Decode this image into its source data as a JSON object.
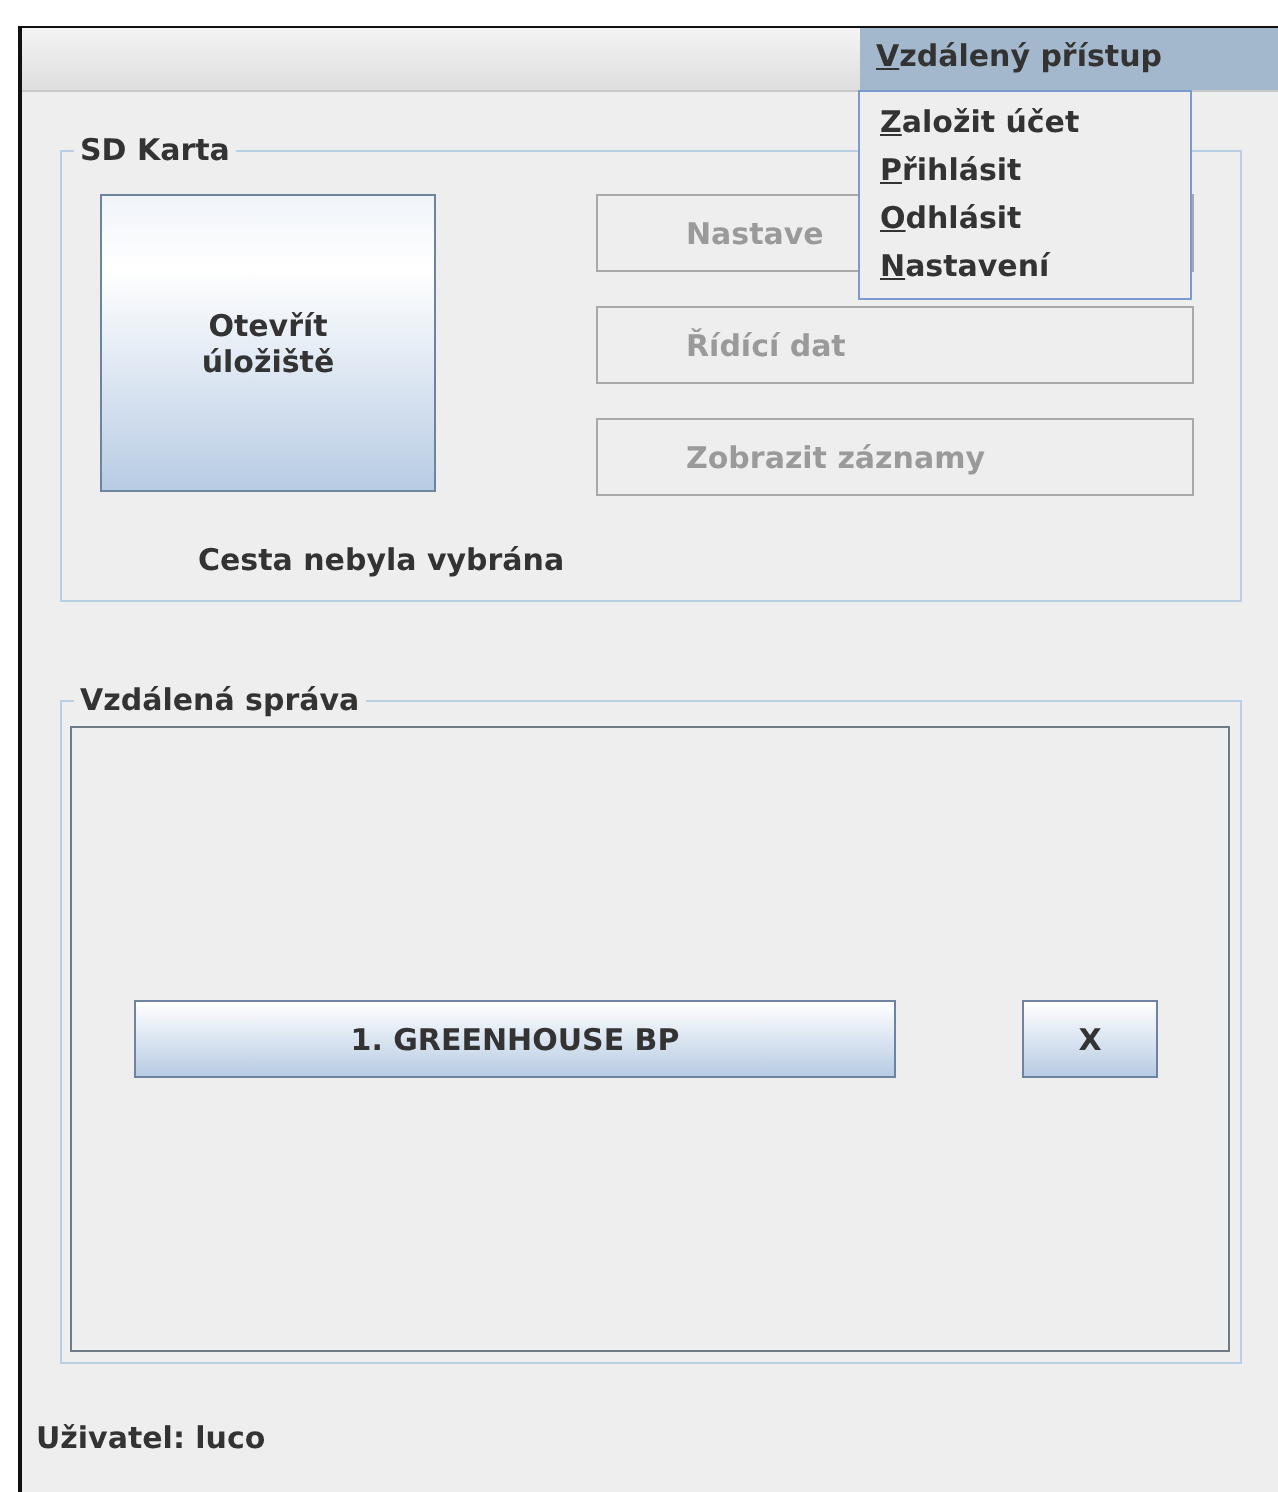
{
  "menu_bar": {
    "menus": [
      {
        "label": "Vzdálený přístup",
        "selected": true
      }
    ]
  },
  "open_menu": {
    "items": [
      {
        "label": "Založit účet"
      },
      {
        "label": "Přihlásit"
      },
      {
        "label": "Odhlásit"
      },
      {
        "label": "Nastavení"
      }
    ]
  },
  "sd_card": {
    "title": "SD Karta",
    "open_button": "Otevřít úložiště",
    "buttons": [
      {
        "label": "Nastave",
        "disabled": true
      },
      {
        "label": "Řídící dat",
        "disabled": true
      },
      {
        "label": "Zobrazit záznamy",
        "disabled": true
      }
    ],
    "path_label": "Cesta nebyla vybrána"
  },
  "remote": {
    "title": "Vzdálená správa",
    "devices": [
      {
        "label": "1. GREENHOUSE BP",
        "remove": "X"
      }
    ]
  },
  "status": "Uživatel: luco"
}
